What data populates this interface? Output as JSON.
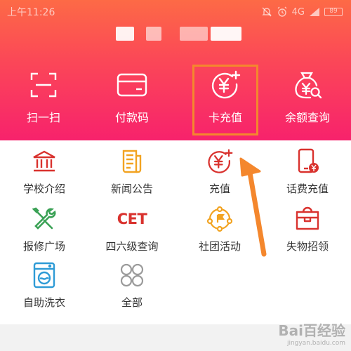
{
  "status_bar": {
    "time": "上午11:26",
    "network": "4G",
    "battery": "89"
  },
  "top_actions": [
    {
      "label": "扫一扫",
      "icon": "scan-icon"
    },
    {
      "label": "付款码",
      "icon": "payment-card-icon"
    },
    {
      "label": "卡充值",
      "icon": "yen-add-icon"
    },
    {
      "label": "余额查询",
      "icon": "money-bag-search-icon"
    }
  ],
  "grid_items": [
    {
      "label": "学校介绍",
      "icon": "school-building-icon"
    },
    {
      "label": "新闻公告",
      "icon": "newspaper-icon"
    },
    {
      "label": "充值",
      "icon": "yen-add-icon"
    },
    {
      "label": "话费充值",
      "icon": "phone-yen-icon"
    },
    {
      "label": "报修广场",
      "icon": "wrench-screwdriver-icon"
    },
    {
      "label": "四六级查询",
      "icon": "cet-text-icon",
      "icon_text": "CET"
    },
    {
      "label": "社团活动",
      "icon": "club-network-icon"
    },
    {
      "label": "失物招领",
      "icon": "lost-found-box-icon"
    },
    {
      "label": "自助洗衣",
      "icon": "washing-machine-icon"
    },
    {
      "label": "全部",
      "icon": "all-apps-icon"
    }
  ],
  "colors": {
    "header_top": "#fd6a46",
    "header_bottom": "#f7226c",
    "highlight": "#f4872d",
    "icon_red": "#d9322e"
  },
  "watermark": {
    "brand": "Bai百经验",
    "url": "jingyan.baidu.com"
  }
}
